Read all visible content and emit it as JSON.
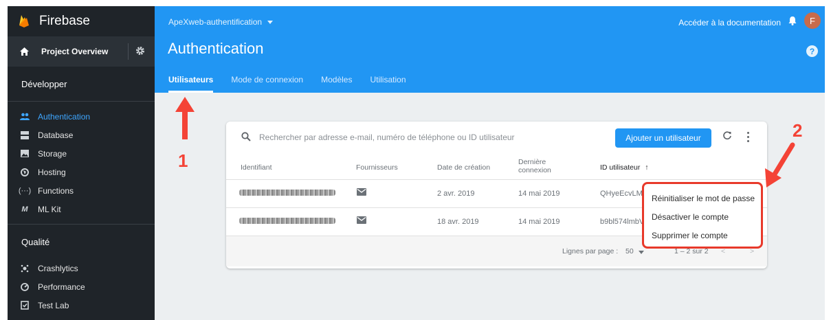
{
  "colors": {
    "sidebar_bg": "#1f2429",
    "header_bg": "#2196f3",
    "accent": "#3ea6ff",
    "annotation": "#f44336",
    "button": "#2196f3"
  },
  "sidebar": {
    "brand": "Firebase",
    "project_overview": "Project Overview",
    "sections": [
      {
        "title": "Développer",
        "items": [
          {
            "label": "Authentication",
            "icon": "people-icon",
            "active": true
          },
          {
            "label": "Database",
            "icon": "database-icon"
          },
          {
            "label": "Storage",
            "icon": "image-icon"
          },
          {
            "label": "Hosting",
            "icon": "globe-icon"
          },
          {
            "label": "Functions",
            "icon": "functions-icon"
          },
          {
            "label": "ML Kit",
            "icon": "ml-icon"
          }
        ]
      },
      {
        "title": "Qualité",
        "items": [
          {
            "label": "Crashlytics",
            "icon": "crashlytics-icon"
          },
          {
            "label": "Performance",
            "icon": "speedometer-icon"
          },
          {
            "label": "Test Lab",
            "icon": "checklist-icon"
          }
        ]
      }
    ]
  },
  "header": {
    "project": "ApeXweb-authentification",
    "doc_link": "Accéder à la documentation",
    "avatar_letter": "F",
    "title": "Authentication",
    "help": "?",
    "tabs": [
      "Utilisateurs",
      "Mode de connexion",
      "Modèles",
      "Utilisation"
    ]
  },
  "card": {
    "search_placeholder": "Rechercher par adresse e-mail, numéro de téléphone ou ID utilisateur",
    "add_button": "Ajouter un utilisateur",
    "columns": [
      "Identifiant",
      "Fournisseurs",
      "Date de création",
      "Dernière connexion",
      "ID utilisateur",
      "↑"
    ],
    "rows": [
      {
        "created": "2 avr. 2019",
        "last_login": "14 mai 2019",
        "uid": "QHyeEcvLMl"
      },
      {
        "created": "18 avr. 2019",
        "last_login": "14 mai 2019",
        "uid": "b9bl574lmbV"
      }
    ],
    "footer": {
      "rows_per_page_label": "Lignes par page :",
      "rows_per_page": "50",
      "range": "1 – 2 sur 2",
      "prev": "<",
      "next": ">"
    }
  },
  "context_menu": [
    "Réinitialiser le mot de passe",
    "Désactiver le compte",
    "Supprimer le compte"
  ],
  "annotations": {
    "one": "1",
    "two": "2"
  }
}
